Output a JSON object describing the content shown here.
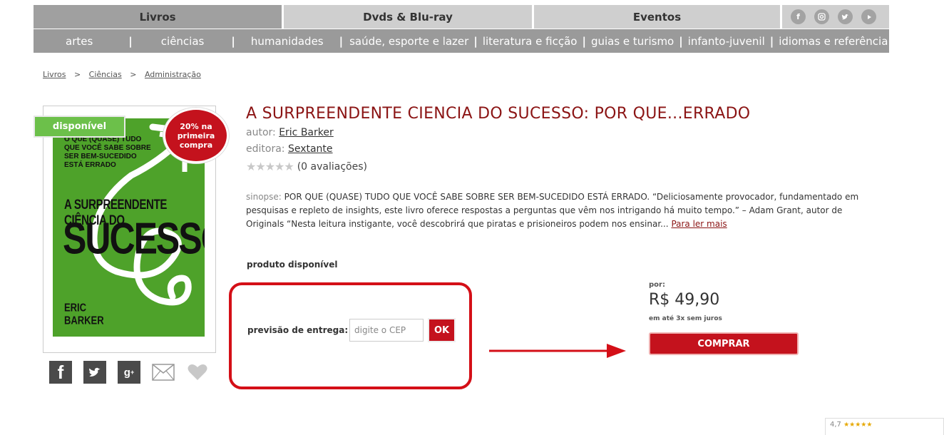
{
  "top_nav": {
    "tabs": [
      {
        "label": "Livros",
        "active": true
      },
      {
        "label": "Dvds & Blu-ray",
        "active": false
      },
      {
        "label": "Eventos",
        "active": false
      }
    ],
    "social_icons": [
      "facebook-icon",
      "instagram-icon",
      "twitter-icon",
      "youtube-icon"
    ]
  },
  "sub_nav": {
    "categories": [
      "artes",
      "ciências",
      "humanidades",
      "saúde, esporte e lazer",
      "literatura e ficção",
      "guias e turismo",
      "infanto-juvenil",
      "idiomas e referência"
    ],
    "separator": "|"
  },
  "breadcrumb": {
    "items": [
      "Livros",
      "Ciências",
      "Administração"
    ],
    "separator": ">"
  },
  "book": {
    "cover": {
      "small_text": [
        "O QUE (QUASE) TUDO",
        "QUE VOCÊ SABE SOBRE",
        "SER BEM-SUCEDIDO",
        "ESTÁ ERRADO"
      ],
      "title_line1": "A SURPREENDENTE CIÊNCIA DO",
      "title_line2": "SUCESSO",
      "author_line1": "ERIC",
      "author_line2": "BARKER",
      "color": "#4ea22a"
    },
    "badge_available": "disponível",
    "badge_promo": "20% na primeira compra",
    "title": "A SURPREENDENTE CIENCIA DO SUCESSO: POR QUE...ERRADO",
    "autor_label": "autor:",
    "autor": "Eric Barker",
    "editora_label": "editora:",
    "editora": "Sextante",
    "rating_stars": "★★★★★",
    "rating_count": "(0 avaliações)",
    "sinopse_label": "sinopse:",
    "sinopse_text": "POR QUE (QUASE) TUDO QUE VOCÊ SABE SOBRE SER BEM-SUCEDIDO ESTÁ ERRADO. “Deliciosamente provocador, fundamentado em pesquisas e repleto de insights, este livro oferece respostas a perguntas que vêm nos intrigando há muito tempo.” – Adam Grant, autor de Originals “Nesta leitura instigante, você descobrirá que piratas e prisioneiros podem nos ensinar...",
    "read_more": "Para ler mais"
  },
  "availability": "produto disponível",
  "delivery": {
    "label": "previsão de entrega:",
    "placeholder": "digite o CEP",
    "ok_label": "OK"
  },
  "price": {
    "por_label": "por:",
    "value": "R$ 49,90",
    "installments": "em até 3x sem juros",
    "buy_label": "COMPRAR"
  },
  "share_icons": [
    "facebook-share-icon",
    "twitter-share-icon",
    "google-plus-share-icon",
    "email-share-icon",
    "heart-favorite-icon"
  ],
  "review_widget": {
    "score": "4,7",
    "stars": "★★★★★"
  },
  "colors": {
    "brand_red": "#c4121d",
    "title_red": "#8b1414",
    "available_green": "#6cc04a",
    "annotation_red": "#d40f17"
  }
}
